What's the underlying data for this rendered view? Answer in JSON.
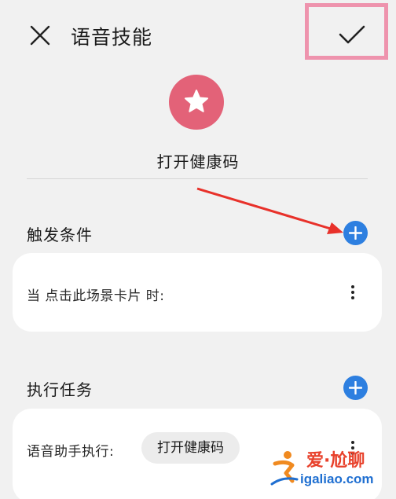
{
  "header": {
    "title": "语音技能",
    "close_icon": "close-icon",
    "confirm_icon": "check-icon"
  },
  "skill": {
    "icon": "star-icon",
    "icon_color": "#e36278",
    "name": "打开健康码"
  },
  "trigger_section": {
    "title": "触发条件",
    "add_icon": "plus-icon",
    "condition_text": "当 点击此场景卡片 时:"
  },
  "action_section": {
    "title": "执行任务",
    "add_icon": "plus-icon",
    "action_label": "语音助手执行:",
    "action_chip": "打开健康码"
  },
  "watermark": {
    "top": "爱·尬聊",
    "bottom": "igaliao.com"
  },
  "colors": {
    "accent_blue": "#2d7fe0",
    "highlight_pink": "#ee93ad",
    "annotation_red": "#e8312a"
  }
}
